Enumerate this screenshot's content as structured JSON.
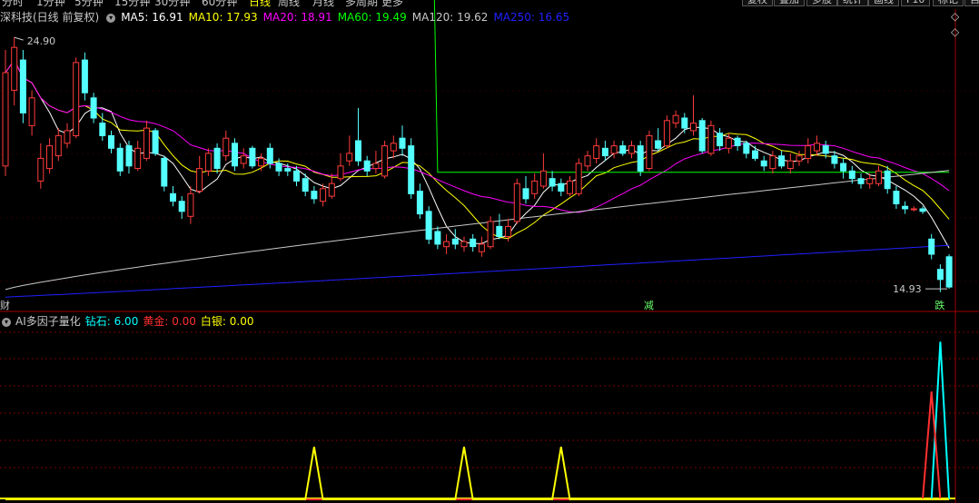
{
  "toolbar": {
    "periods": [
      "分时",
      "1分钟",
      "5分钟",
      "15分钟",
      "30分钟",
      "60分钟",
      "日线",
      "周线",
      "月线",
      "多周期",
      "更多"
    ],
    "active_period": "日线",
    "buttons": [
      "复权",
      "叠加",
      "多股",
      "统计",
      "画线",
      "F10",
      "标记",
      "自"
    ]
  },
  "header": {
    "stock_name": "深科技(日线 前复权)",
    "ma": [
      {
        "label": "MA5: 16.91",
        "color": "#ffffff"
      },
      {
        "label": "MA10: 17.93",
        "color": "#ffff00"
      },
      {
        "label": "MA20: 18.91",
        "color": "#ff00ff"
      },
      {
        "label": "MA60: 19.49",
        "color": "#00ff00"
      },
      {
        "label": "MA120: 19.62",
        "color": "#c8c8c8"
      },
      {
        "label": "MA250: 16.65",
        "color": "#2020ff"
      }
    ]
  },
  "indicator_header": {
    "name": "AI多因子量化",
    "items": [
      {
        "label": "钻石: 6.00",
        "color": "#00ffff"
      },
      {
        "label": "黄金: 0.00",
        "color": "#ff3030"
      },
      {
        "label": "白银: 0.00",
        "color": "#ffff00"
      }
    ]
  },
  "colors": {
    "up": "#ff3b3b",
    "down": "#54ffff",
    "grid": "#7a0000",
    "axis": "#a00000",
    "bg": "#000000"
  },
  "chart_data": [
    {
      "type": "candlestick",
      "title": "深科技(日线 前复权)",
      "price_high_label": "24.90",
      "price_low_label": "14.93",
      "ylim": [
        14.5,
        25.3
      ],
      "marker_labels": [
        {
          "text": "财",
          "index": 0
        },
        {
          "text": "减",
          "index": 73
        },
        {
          "text": "跌",
          "index": 106
        }
      ],
      "candles": [
        {
          "o": 19.8,
          "c": 23.5,
          "h": 24.4,
          "l": 19.4
        },
        {
          "o": 22.8,
          "c": 24.5,
          "h": 24.9,
          "l": 22.2
        },
        {
          "o": 24.0,
          "c": 21.9,
          "h": 24.4,
          "l": 21.5
        },
        {
          "o": 21.4,
          "c": 22.5,
          "h": 22.8,
          "l": 21.0
        },
        {
          "o": 19.2,
          "c": 20.1,
          "h": 20.7,
          "l": 18.9
        },
        {
          "o": 19.7,
          "c": 20.6,
          "h": 20.9,
          "l": 19.5
        },
        {
          "o": 20.2,
          "c": 21.0,
          "h": 21.3,
          "l": 20.0
        },
        {
          "o": 20.7,
          "c": 21.2,
          "h": 21.5,
          "l": 20.5
        },
        {
          "o": 21.0,
          "c": 23.9,
          "h": 24.1,
          "l": 20.9
        },
        {
          "o": 24.0,
          "c": 22.7,
          "h": 24.3,
          "l": 22.4
        },
        {
          "o": 22.5,
          "c": 21.7,
          "h": 22.7,
          "l": 21.5
        },
        {
          "o": 21.5,
          "c": 21.0,
          "h": 21.9,
          "l": 20.8
        },
        {
          "o": 21.0,
          "c": 20.5,
          "h": 21.2,
          "l": 20.3
        },
        {
          "o": 20.5,
          "c": 19.6,
          "h": 20.7,
          "l": 19.4
        },
        {
          "o": 20.6,
          "c": 19.8,
          "h": 20.8,
          "l": 19.5
        },
        {
          "o": 19.7,
          "c": 20.5,
          "h": 20.8,
          "l": 19.6
        },
        {
          "o": 20.1,
          "c": 21.3,
          "h": 21.6,
          "l": 20.0
        },
        {
          "o": 21.2,
          "c": 20.3,
          "h": 21.3,
          "l": 20.2
        },
        {
          "o": 20.1,
          "c": 19.0,
          "h": 20.2,
          "l": 18.8
        },
        {
          "o": 18.7,
          "c": 18.4,
          "h": 19.0,
          "l": 18.2
        },
        {
          "o": 18.4,
          "c": 18.0,
          "h": 18.6,
          "l": 17.7
        },
        {
          "o": 17.8,
          "c": 18.7,
          "h": 19.0,
          "l": 17.5
        },
        {
          "o": 18.8,
          "c": 19.7,
          "h": 20.2,
          "l": 18.7
        },
        {
          "o": 19.6,
          "c": 20.3,
          "h": 20.5,
          "l": 19.4
        },
        {
          "o": 20.5,
          "c": 19.7,
          "h": 20.7,
          "l": 19.5
        },
        {
          "o": 20.2,
          "c": 20.9,
          "h": 21.2,
          "l": 20.0
        },
        {
          "o": 20.7,
          "c": 19.8,
          "h": 20.9,
          "l": 19.6
        },
        {
          "o": 19.9,
          "c": 20.2,
          "h": 20.5,
          "l": 19.7
        },
        {
          "o": 20.5,
          "c": 19.8,
          "h": 20.6,
          "l": 19.7
        },
        {
          "o": 19.8,
          "c": 20.1,
          "h": 20.3,
          "l": 19.6
        },
        {
          "o": 20.5,
          "c": 19.9,
          "h": 20.7,
          "l": 19.7
        },
        {
          "o": 19.9,
          "c": 19.6,
          "h": 20.1,
          "l": 19.4
        },
        {
          "o": 19.7,
          "c": 19.6,
          "h": 19.9,
          "l": 19.4
        },
        {
          "o": 19.6,
          "c": 19.2,
          "h": 19.8,
          "l": 19.0
        },
        {
          "o": 19.3,
          "c": 18.8,
          "h": 19.5,
          "l": 18.6
        },
        {
          "o": 18.8,
          "c": 18.5,
          "h": 19.0,
          "l": 18.3
        },
        {
          "o": 18.4,
          "c": 18.9,
          "h": 19.1,
          "l": 18.2
        },
        {
          "o": 18.6,
          "c": 19.1,
          "h": 19.5,
          "l": 18.5
        },
        {
          "o": 19.3,
          "c": 19.8,
          "h": 20.3,
          "l": 19.2
        },
        {
          "o": 20.0,
          "c": 20.3,
          "h": 21.0,
          "l": 19.8
        },
        {
          "o": 20.8,
          "c": 20.0,
          "h": 22.1,
          "l": 19.8
        },
        {
          "o": 20.0,
          "c": 19.6,
          "h": 20.2,
          "l": 19.4
        },
        {
          "o": 19.7,
          "c": 19.9,
          "h": 20.4,
          "l": 19.5
        },
        {
          "o": 19.4,
          "c": 20.6,
          "h": 20.8,
          "l": 19.3
        },
        {
          "o": 20.4,
          "c": 20.7,
          "h": 21.0,
          "l": 20.1
        },
        {
          "o": 20.9,
          "c": 20.5,
          "h": 21.4,
          "l": 20.2
        },
        {
          "o": 20.6,
          "c": 18.7,
          "h": 20.9,
          "l": 18.5
        },
        {
          "o": 18.8,
          "c": 17.9,
          "h": 19.1,
          "l": 17.7
        },
        {
          "o": 18.0,
          "c": 16.9,
          "h": 18.2,
          "l": 16.7
        },
        {
          "o": 17.2,
          "c": 16.7,
          "h": 17.4,
          "l": 16.5
        },
        {
          "o": 16.6,
          "c": 16.8,
          "h": 17.1,
          "l": 16.3
        },
        {
          "o": 16.9,
          "c": 16.7,
          "h": 17.3,
          "l": 16.5
        },
        {
          "o": 16.6,
          "c": 16.8,
          "h": 17.0,
          "l": 16.4
        },
        {
          "o": 16.9,
          "c": 16.6,
          "h": 17.1,
          "l": 16.4
        },
        {
          "o": 16.4,
          "c": 16.7,
          "h": 17.0,
          "l": 16.2
        },
        {
          "o": 16.6,
          "c": 17.6,
          "h": 17.8,
          "l": 16.5
        },
        {
          "o": 17.4,
          "c": 17.0,
          "h": 17.9,
          "l": 16.9
        },
        {
          "o": 17.0,
          "c": 17.4,
          "h": 17.7,
          "l": 16.8
        },
        {
          "o": 17.6,
          "c": 19.1,
          "h": 19.3,
          "l": 17.5
        },
        {
          "o": 18.9,
          "c": 18.5,
          "h": 19.4,
          "l": 18.3
        },
        {
          "o": 18.7,
          "c": 19.2,
          "h": 19.5,
          "l": 18.5
        },
        {
          "o": 19.0,
          "c": 19.6,
          "h": 20.3,
          "l": 18.9
        },
        {
          "o": 19.3,
          "c": 19.0,
          "h": 19.6,
          "l": 18.8
        },
        {
          "o": 19.1,
          "c": 18.8,
          "h": 19.3,
          "l": 18.6
        },
        {
          "o": 18.7,
          "c": 19.2,
          "h": 19.4,
          "l": 18.6
        },
        {
          "o": 18.7,
          "c": 19.9,
          "h": 20.1,
          "l": 18.6
        },
        {
          "o": 19.8,
          "c": 20.2,
          "h": 20.4,
          "l": 19.6
        },
        {
          "o": 20.1,
          "c": 20.6,
          "h": 20.9,
          "l": 19.9
        },
        {
          "o": 20.5,
          "c": 20.2,
          "h": 20.8,
          "l": 20.0
        },
        {
          "o": 20.3,
          "c": 20.6,
          "h": 20.8,
          "l": 20.1
        },
        {
          "o": 20.6,
          "c": 20.3,
          "h": 20.8,
          "l": 20.2
        },
        {
          "o": 20.3,
          "c": 20.6,
          "h": 20.8,
          "l": 20.1
        },
        {
          "o": 20.6,
          "c": 19.6,
          "h": 20.8,
          "l": 19.4
        },
        {
          "o": 19.7,
          "c": 21.0,
          "h": 21.2,
          "l": 19.6
        },
        {
          "o": 20.8,
          "c": 20.5,
          "h": 21.3,
          "l": 20.4
        },
        {
          "o": 20.6,
          "c": 21.6,
          "h": 21.8,
          "l": 20.5
        },
        {
          "o": 21.5,
          "c": 21.8,
          "h": 22.0,
          "l": 21.3
        },
        {
          "o": 21.7,
          "c": 21.3,
          "h": 21.9,
          "l": 21.1
        },
        {
          "o": 21.2,
          "c": 21.5,
          "h": 22.6,
          "l": 21.0
        },
        {
          "o": 21.6,
          "c": 20.4,
          "h": 21.7,
          "l": 20.3
        },
        {
          "o": 20.3,
          "c": 21.4,
          "h": 21.6,
          "l": 20.2
        },
        {
          "o": 21.1,
          "c": 20.6,
          "h": 21.3,
          "l": 20.4
        },
        {
          "o": 20.5,
          "c": 20.9,
          "h": 21.1,
          "l": 20.3
        },
        {
          "o": 20.9,
          "c": 20.6,
          "h": 21.0,
          "l": 20.4
        },
        {
          "o": 20.7,
          "c": 20.3,
          "h": 20.8,
          "l": 20.1
        },
        {
          "o": 20.4,
          "c": 20.1,
          "h": 20.6,
          "l": 20.0
        },
        {
          "o": 20.0,
          "c": 19.8,
          "h": 20.2,
          "l": 19.6
        },
        {
          "o": 19.7,
          "c": 20.2,
          "h": 20.4,
          "l": 19.5
        },
        {
          "o": 20.2,
          "c": 19.8,
          "h": 20.4,
          "l": 19.7
        },
        {
          "o": 19.7,
          "c": 20.0,
          "h": 20.3,
          "l": 19.5
        },
        {
          "o": 20.0,
          "c": 20.2,
          "h": 20.4,
          "l": 19.8
        },
        {
          "o": 20.1,
          "c": 20.6,
          "h": 20.9,
          "l": 19.9
        },
        {
          "o": 20.4,
          "c": 20.7,
          "h": 21.0,
          "l": 20.2
        },
        {
          "o": 20.6,
          "c": 20.3,
          "h": 20.8,
          "l": 20.1
        },
        {
          "o": 20.2,
          "c": 19.9,
          "h": 20.4,
          "l": 19.7
        },
        {
          "o": 19.9,
          "c": 19.6,
          "h": 20.1,
          "l": 19.3
        },
        {
          "o": 19.6,
          "c": 19.3,
          "h": 19.8,
          "l": 19.1
        },
        {
          "o": 19.3,
          "c": 19.1,
          "h": 19.5,
          "l": 18.9
        },
        {
          "o": 19.1,
          "c": 19.3,
          "h": 19.5,
          "l": 18.9
        },
        {
          "o": 19.1,
          "c": 19.6,
          "h": 19.8,
          "l": 19.0
        },
        {
          "o": 19.6,
          "c": 18.9,
          "h": 19.8,
          "l": 18.7
        },
        {
          "o": 18.8,
          "c": 18.3,
          "h": 19.0,
          "l": 18.1
        },
        {
          "o": 18.2,
          "c": 18.1,
          "h": 18.4,
          "l": 17.9
        },
        {
          "o": 18.1,
          "c": 18.1,
          "h": 18.2,
          "l": 18.0
        },
        {
          "o": 18.1,
          "c": 18.0,
          "h": 18.2,
          "l": 17.9
        },
        {
          "o": 16.9,
          "c": 16.3,
          "h": 17.1,
          "l": 16.1
        },
        {
          "o": 15.7,
          "c": 15.3,
          "h": 15.9,
          "l": 14.8
        },
        {
          "o": 16.2,
          "c": 15.0,
          "h": 16.3,
          "l": 14.93
        }
      ],
      "moving_averages": [
        {
          "name": "MA5",
          "period": 5,
          "color": "#ffffff"
        },
        {
          "name": "MA10",
          "period": 10,
          "color": "#ffff00"
        },
        {
          "name": "MA20",
          "period": 20,
          "color": "#ff00ff"
        },
        {
          "name": "MA60",
          "period": 60,
          "color": "#00ff00",
          "start": 19.0,
          "end": 19.49
        },
        {
          "name": "MA120",
          "period": 120,
          "color": "#c8c8c8",
          "start": 14.9,
          "end": 19.62
        },
        {
          "name": "MA250",
          "period": 250,
          "color": "#2020ff",
          "start": 14.6,
          "end": 16.65
        }
      ]
    },
    {
      "type": "line",
      "title": "AI多因子量化",
      "ylim": [
        0,
        6.5
      ],
      "series": [
        {
          "name": "钻石",
          "color": "#00ffff",
          "nonzero": [
            {
              "index": 106,
              "value": 6.0
            }
          ]
        },
        {
          "name": "黄金",
          "color": "#ff3030",
          "nonzero": [
            {
              "index": 105,
              "value": 4.1
            }
          ]
        },
        {
          "name": "白银",
          "color": "#ffff00",
          "nonzero": [
            {
              "index": 35,
              "value": 2.0
            },
            {
              "index": 52,
              "value": 2.0
            },
            {
              "index": 63,
              "value": 2.0
            }
          ]
        }
      ]
    }
  ]
}
